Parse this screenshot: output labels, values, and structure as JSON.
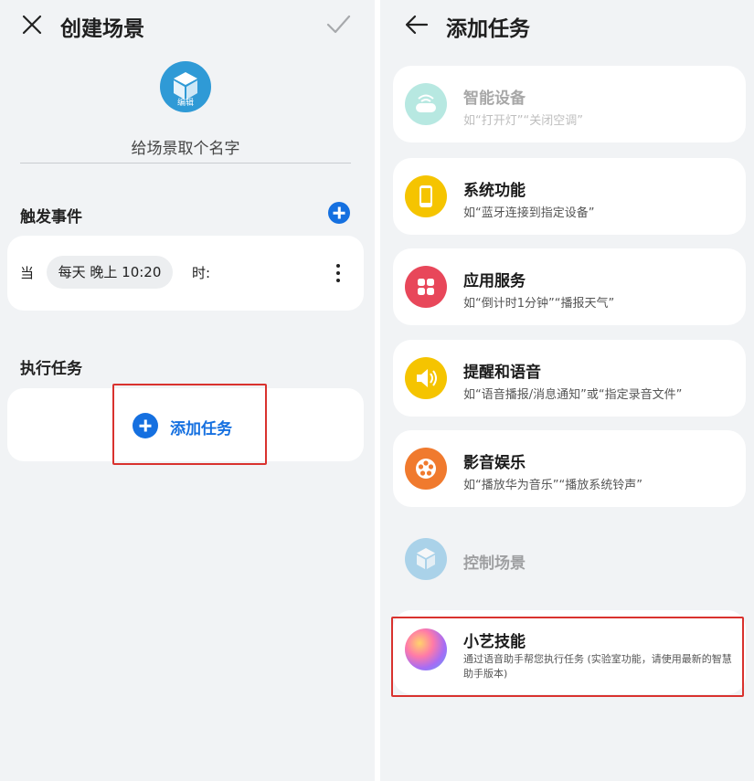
{
  "left": {
    "header": {
      "title": "创建场景"
    },
    "scene_icon_label": "编辑",
    "name_placeholder": "给场景取个名字",
    "trigger": {
      "section_title": "触发事件",
      "prefix": "当",
      "time_pill": "每天 晚上 10:20",
      "suffix": "时:"
    },
    "tasks": {
      "section_title": "执行任务",
      "add_label": "添加任务"
    }
  },
  "right": {
    "header": {
      "title": "添加任务"
    },
    "items": [
      {
        "title": "智能设备",
        "subtitle": "如“打开灯”“关闭空调”",
        "icon": "smart-device-icon",
        "color": "#43c3b3",
        "disabled": true
      },
      {
        "title": "系统功能",
        "subtitle": "如“蓝牙连接到指定设备”",
        "icon": "phone-icon",
        "color": "#f5c400",
        "disabled": false
      },
      {
        "title": "应用服务",
        "subtitle": "如“倒计时1分钟”“播报天气”",
        "icon": "app-grid-icon",
        "color": "#e8475a",
        "disabled": false
      },
      {
        "title": "提醒和语音",
        "subtitle": "如“语音播报/消息通知”或“指定录音文件”",
        "icon": "speaker-icon",
        "color": "#f5c400",
        "disabled": false
      },
      {
        "title": "影音娱乐",
        "subtitle": "如“播放华为音乐”“播放系统铃声”",
        "icon": "film-reel-icon",
        "color": "#f07a2e",
        "disabled": false
      },
      {
        "title": "控制场景",
        "subtitle": "",
        "icon": "cube-icon",
        "color": "#3a9fd8",
        "disabled": true
      },
      {
        "title": "小艺技能",
        "subtitle": "通过语音助手帮您执行任务 (实验室功能，请使用最新的智慧助手版本)",
        "icon": "xiaoyi-orb-icon",
        "color": "#b46cf0",
        "disabled": false
      }
    ]
  },
  "colors": {
    "accent": "#1570e0",
    "highlight": "#d9322e",
    "background": "#f1f3f5"
  }
}
